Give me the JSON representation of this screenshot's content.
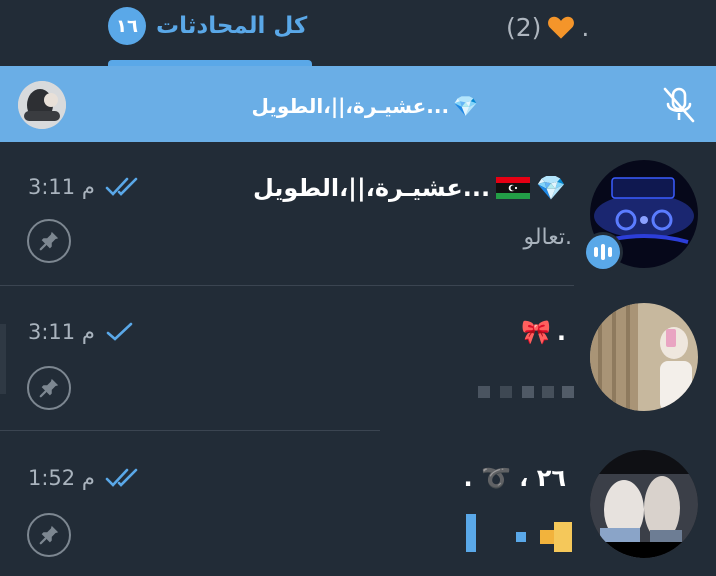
{
  "tabs": {
    "all_label": "كل المحادثات",
    "all_badge": "١٦",
    "other_label": "(2)",
    "other_suffix": "."
  },
  "pinned": {
    "title": "عشيـرة،||،الطويل...",
    "title_emoji": "💎"
  },
  "chats": [
    {
      "name": "عشيـرة،||،الطويل...",
      "name_prefix_emoji": "💎",
      "preview": "تعالو.",
      "time": "3:11 م",
      "read_status": "double-check"
    },
    {
      "name": ".",
      "name_emoji": "🎀",
      "preview": "",
      "time": "3:11 م",
      "read_status": "single-check"
    },
    {
      "name": ". ➰ ، ٢٦",
      "preview": "",
      "time": "1:52 م",
      "read_status": "double-check"
    }
  ],
  "colors": {
    "background": "#222c37",
    "accent": "#5aa8e8",
    "pinned_bar": "#6aaee6",
    "muted_text": "#a9b3bd"
  },
  "icons": {
    "mute": "mute-microphone-icon",
    "pin": "pin-icon",
    "check": "double-check-icon",
    "voice": "voice-chat-icon"
  }
}
